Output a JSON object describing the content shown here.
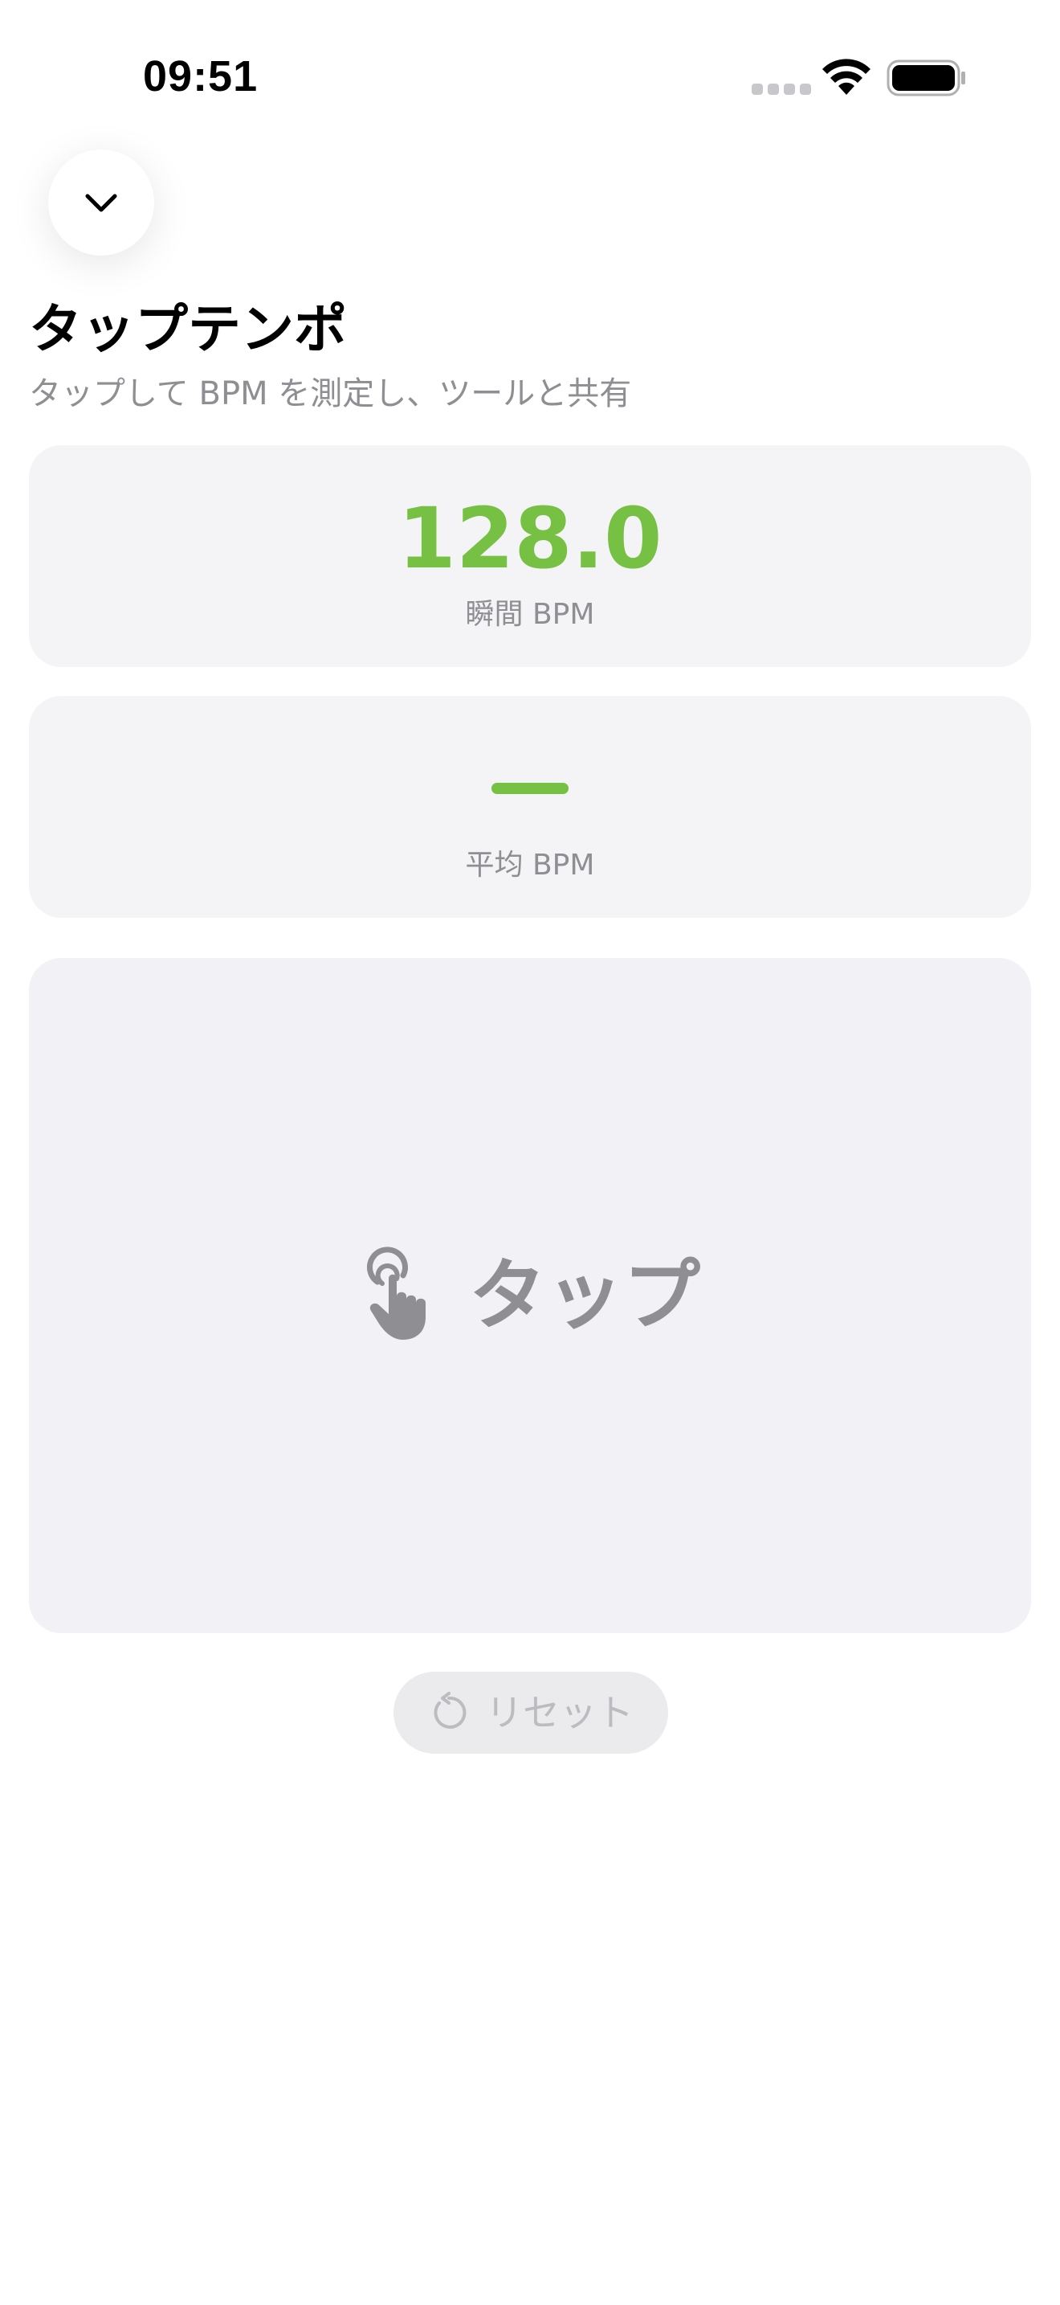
{
  "status_bar": {
    "time": "09:51"
  },
  "header": {
    "title": "タップテンポ",
    "subtitle": "タップして BPM を測定し、ツールと共有"
  },
  "instant_card": {
    "value": "128.0",
    "label": "瞬間 BPM"
  },
  "average_card": {
    "value": "—",
    "label": "平均 BPM"
  },
  "tap_pad": {
    "label": "タップ",
    "icon": "hand-tap-icon"
  },
  "reset_button": {
    "label": "リセット",
    "icon": "reset-arrow-icon"
  },
  "colors": {
    "accent": "#76c043",
    "secondary_text": "#8e8e93",
    "card_background": "#f4f4f6",
    "tap_pad_background": "#f2f2f6"
  }
}
